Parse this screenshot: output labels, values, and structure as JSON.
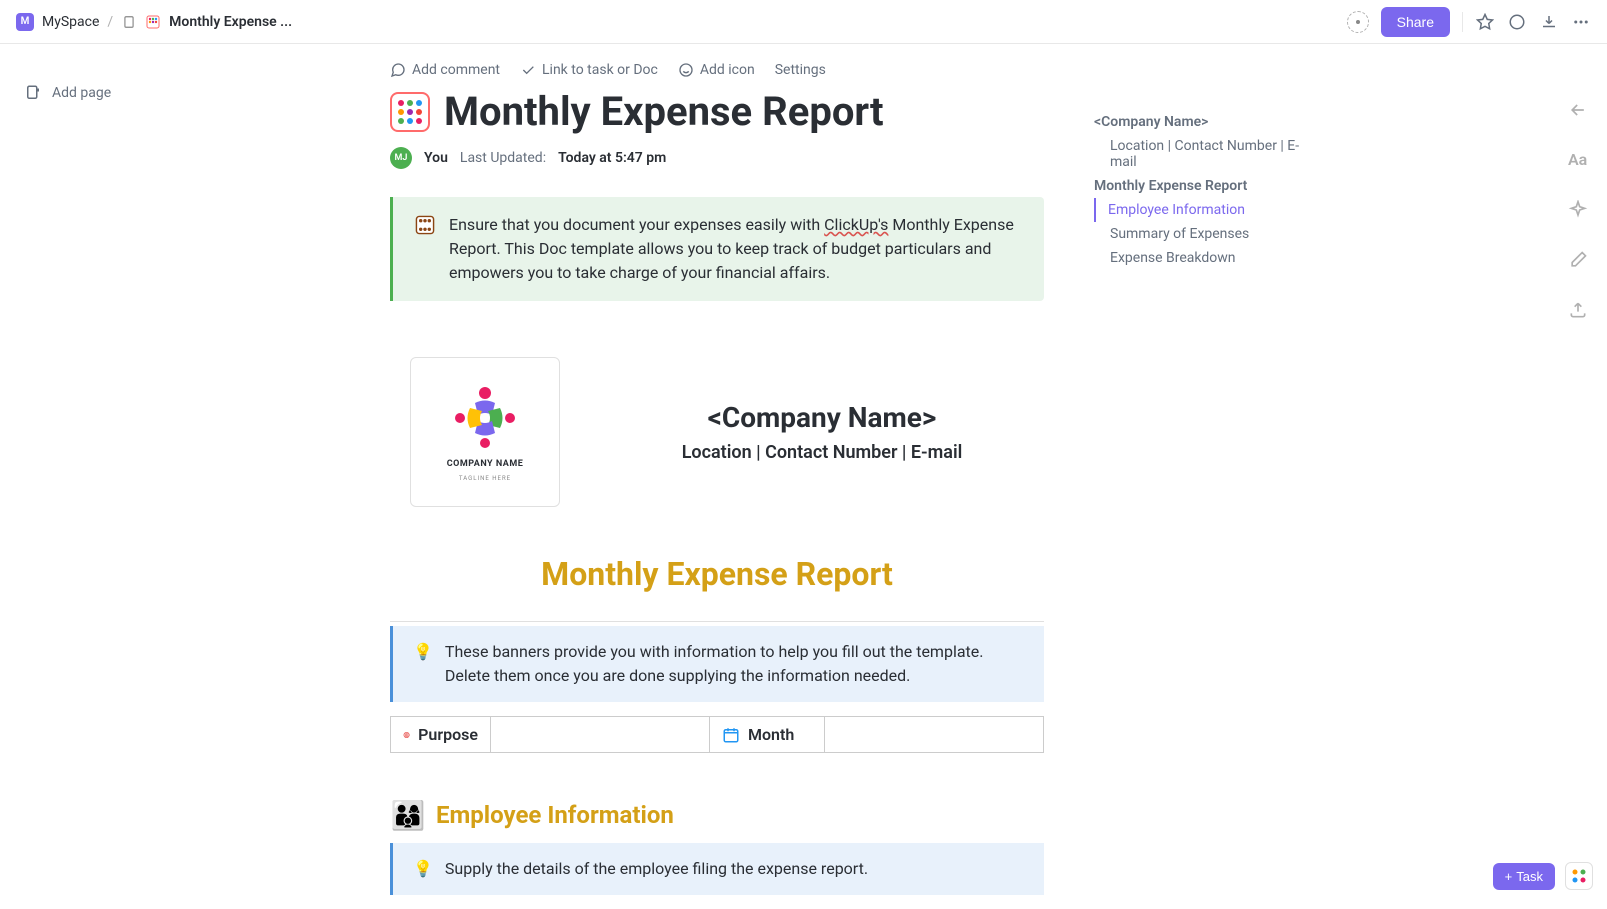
{
  "breadcrumb": {
    "workspace_initial": "M",
    "workspace": "MySpace",
    "doc_title": "Monthly Expense ..."
  },
  "topbar": {
    "share": "Share"
  },
  "sidebar": {
    "add_page": "Add page"
  },
  "toolbar": {
    "add_comment": "Add comment",
    "link_task": "Link to task or Doc",
    "add_icon": "Add icon",
    "settings": "Settings"
  },
  "page": {
    "title": "Monthly Expense Report",
    "avatar_initials": "MJ",
    "author": "You",
    "updated_label": "Last Updated:",
    "updated_time": "Today at 5:47 pm"
  },
  "callout": {
    "text_before": "Ensure that you document your expenses easily with ",
    "link_text": "ClickUp's",
    "text_after": " Monthly Expense Report. This Doc template allows you to keep track of budget particulars and empowers you to take charge of your financial affairs."
  },
  "company": {
    "logo_name": "COMPANY NAME",
    "logo_tagline": "TAGLINE HERE",
    "name": "<Company Name>",
    "subtitle": "Location | Contact Number | E-mail"
  },
  "section": {
    "report_title": "Monthly Expense Report",
    "info_banner": "These banners provide you with information to help you fill out the template. Delete them once you are done supplying the information needed.",
    "purpose_label": "Purpose",
    "month_label": "Month",
    "employee_title": "Employee Information",
    "employee_banner": "Supply the details of the employee filing the expense report."
  },
  "outline": {
    "items": [
      {
        "label": "<Company Name>",
        "indent": false,
        "active": false
      },
      {
        "label": "Location | Contact Number | E-mail",
        "indent": true,
        "active": false
      },
      {
        "label": "Monthly Expense Report",
        "indent": false,
        "active": false
      },
      {
        "label": "Employee Information",
        "indent": true,
        "active": true
      },
      {
        "label": "Summary of Expenses",
        "indent": true,
        "active": false
      },
      {
        "label": "Expense Breakdown",
        "indent": true,
        "active": false
      }
    ]
  },
  "bottom": {
    "task": "Task"
  }
}
